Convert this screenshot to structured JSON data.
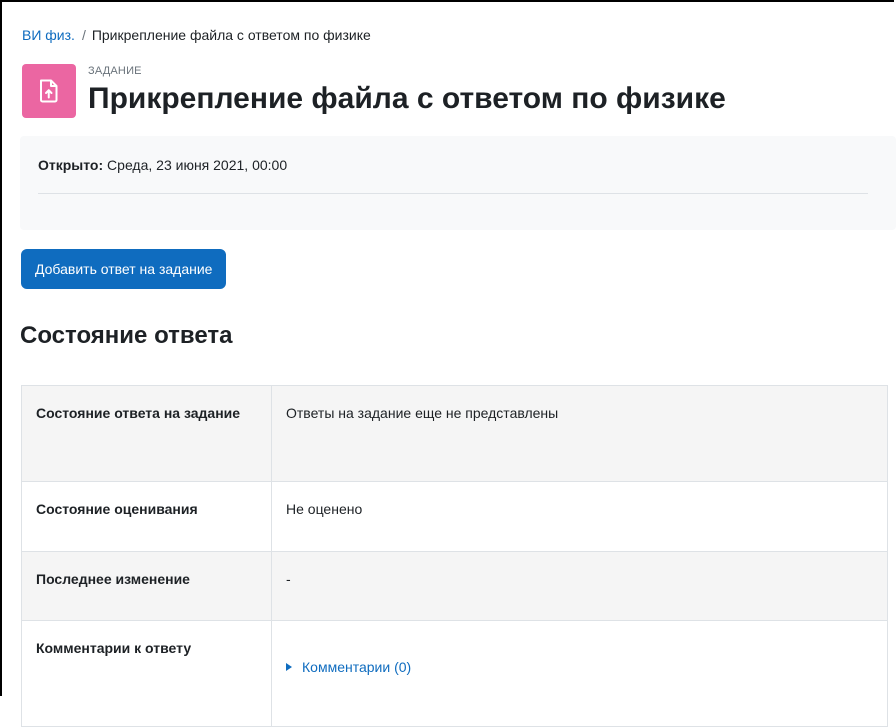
{
  "breadcrumb": {
    "course_link": "ВИ физ.",
    "separator": "/",
    "current": "Прикрепление файла с ответом по физике"
  },
  "header": {
    "icon": "assignment-upload-icon",
    "icon_color": "#eb66a2",
    "pre_title": "ЗАДАНИЕ",
    "title": "Прикрепление файла с ответом по физике"
  },
  "dates": {
    "opened_label": "Открыто:",
    "opened_value": "Среда, 23 июня 2021, 00:00"
  },
  "actions": {
    "add_submission_label": "Добавить ответ на задание",
    "button_color": "#0f6cbf"
  },
  "submission_status": {
    "heading": "Состояние ответа",
    "rows": [
      {
        "label": "Состояние ответа на задание",
        "value": "Ответы на задание еще не представлены"
      },
      {
        "label": "Состояние оценивания",
        "value": "Не оценено"
      },
      {
        "label": "Последнее изменение",
        "value": "-"
      },
      {
        "label": "Комментарии к ответу",
        "value": "Комментарии (0)"
      }
    ]
  }
}
